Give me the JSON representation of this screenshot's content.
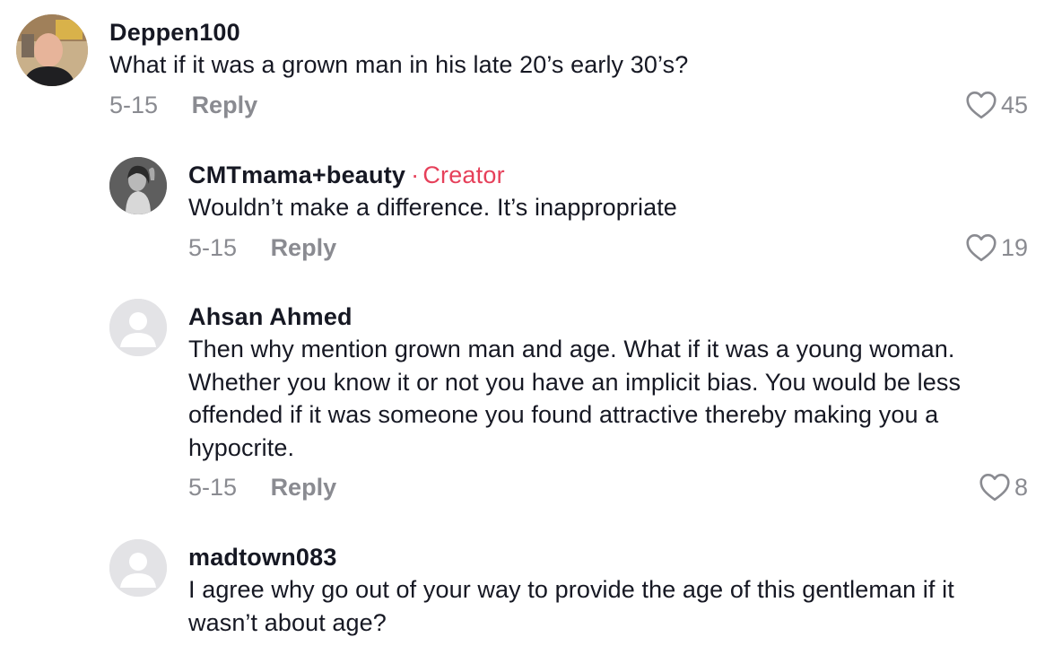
{
  "comments": [
    {
      "username": "Deppen100",
      "text": "What if it was a grown man in his late 20’s early 30’s?",
      "date": "5-15",
      "reply_label": "Reply",
      "likes": "45"
    },
    {
      "username": "CMTmama+beauty",
      "creator_dot": "·",
      "creator_label": "Creator",
      "text": "Wouldn’t make a difference. It’s inappropriate",
      "date": "5-15",
      "reply_label": "Reply",
      "likes": "19"
    },
    {
      "username": "Ahsan Ahmed",
      "text": "Then why mention grown man and age. What if it was a young woman. Whether you know it or not you have an implicit bias. You would be less offended if it was someone you found attractive thereby making you a hypocrite.",
      "date": "5-15",
      "reply_label": "Reply",
      "likes": "8"
    },
    {
      "username": "madtown083",
      "text": "I agree why go out of your way to provide the age of this gentleman if it wasn’t about age?"
    }
  ],
  "colors": {
    "creator": "#e6405a",
    "meta": "#8a8b91",
    "text": "#161823"
  },
  "icons": {
    "like": "heart-outline-icon",
    "default_avatar": "person-silhouette-icon"
  }
}
